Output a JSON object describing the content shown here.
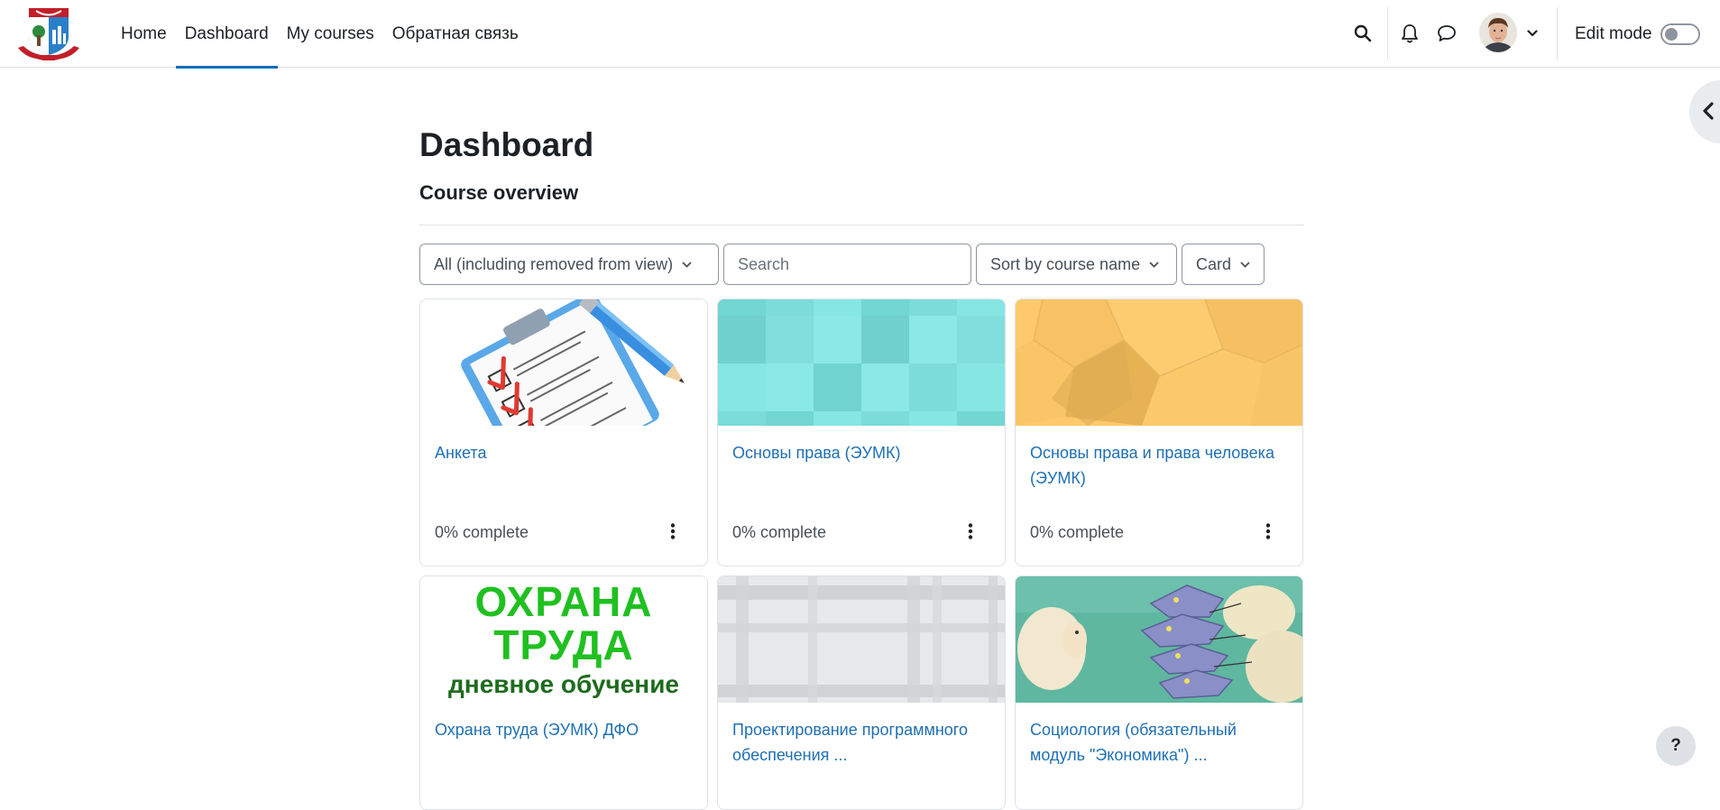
{
  "nav": {
    "links": [
      "Home",
      "Dashboard",
      "My courses",
      "Обратная связь"
    ],
    "active_index": 1,
    "edit_mode_label": "Edit mode",
    "edit_mode_on": false
  },
  "main": {
    "title": "Dashboard",
    "section_title": "Course overview",
    "filters": {
      "grouping": "All (including removed from view)",
      "search_placeholder": "Search",
      "sort": "Sort by course name",
      "view": "Card"
    }
  },
  "courses": [
    {
      "title": "Анкета",
      "progress": "0% complete"
    },
    {
      "title": "Основы права (ЭУМК)",
      "progress": "0% complete"
    },
    {
      "title": "Основы права и права человека (ЭУМК)",
      "progress": "0% complete"
    },
    {
      "title": "Охрана труда (ЭУМК) ДФО",
      "progress": "",
      "image_text": [
        "ОХРАНА",
        "ТРУДА",
        "дневное обучение"
      ]
    },
    {
      "title": "Проектирование программного обеспечения ...",
      "progress": ""
    },
    {
      "title": "Социология (обязательный модуль \"Экономика\") ...",
      "progress": ""
    }
  ],
  "help_label": "?",
  "colors": {
    "accent": "#0f6cbf",
    "link": "#1f6fb3"
  }
}
